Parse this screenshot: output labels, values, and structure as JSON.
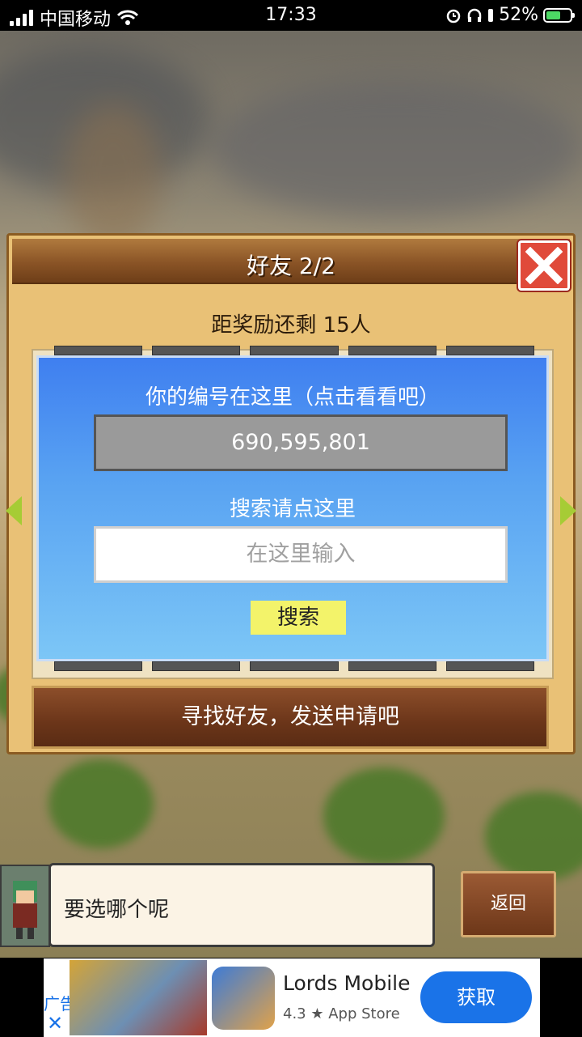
{
  "status_bar": {
    "carrier": "中国移动",
    "time": "17:33",
    "battery_percent": "52%"
  },
  "dialog": {
    "title": "好友 2/2",
    "subtitle": "距奖励还剩 15人",
    "id_label": "你的编号在这里（点击看看吧）",
    "id_value": "690,595,801",
    "search_label": "搜索请点这里",
    "search_placeholder": "在这里输入",
    "search_button": "搜索",
    "find_friends_button": "寻找好友，发送申请吧"
  },
  "bottom": {
    "speech_text": "要选哪个呢",
    "back_button": "返回"
  },
  "ad": {
    "tag": "广告",
    "close_glyph": "✕",
    "app_name": "Lords Mobile",
    "rating": "4.3 ★ App Store",
    "get_button": "获取"
  },
  "colors": {
    "panel_blue": "#3f7ff0",
    "close_red": "#e04a3a",
    "search_yellow": "#f3f36a",
    "ad_blue": "#1a73e8"
  }
}
